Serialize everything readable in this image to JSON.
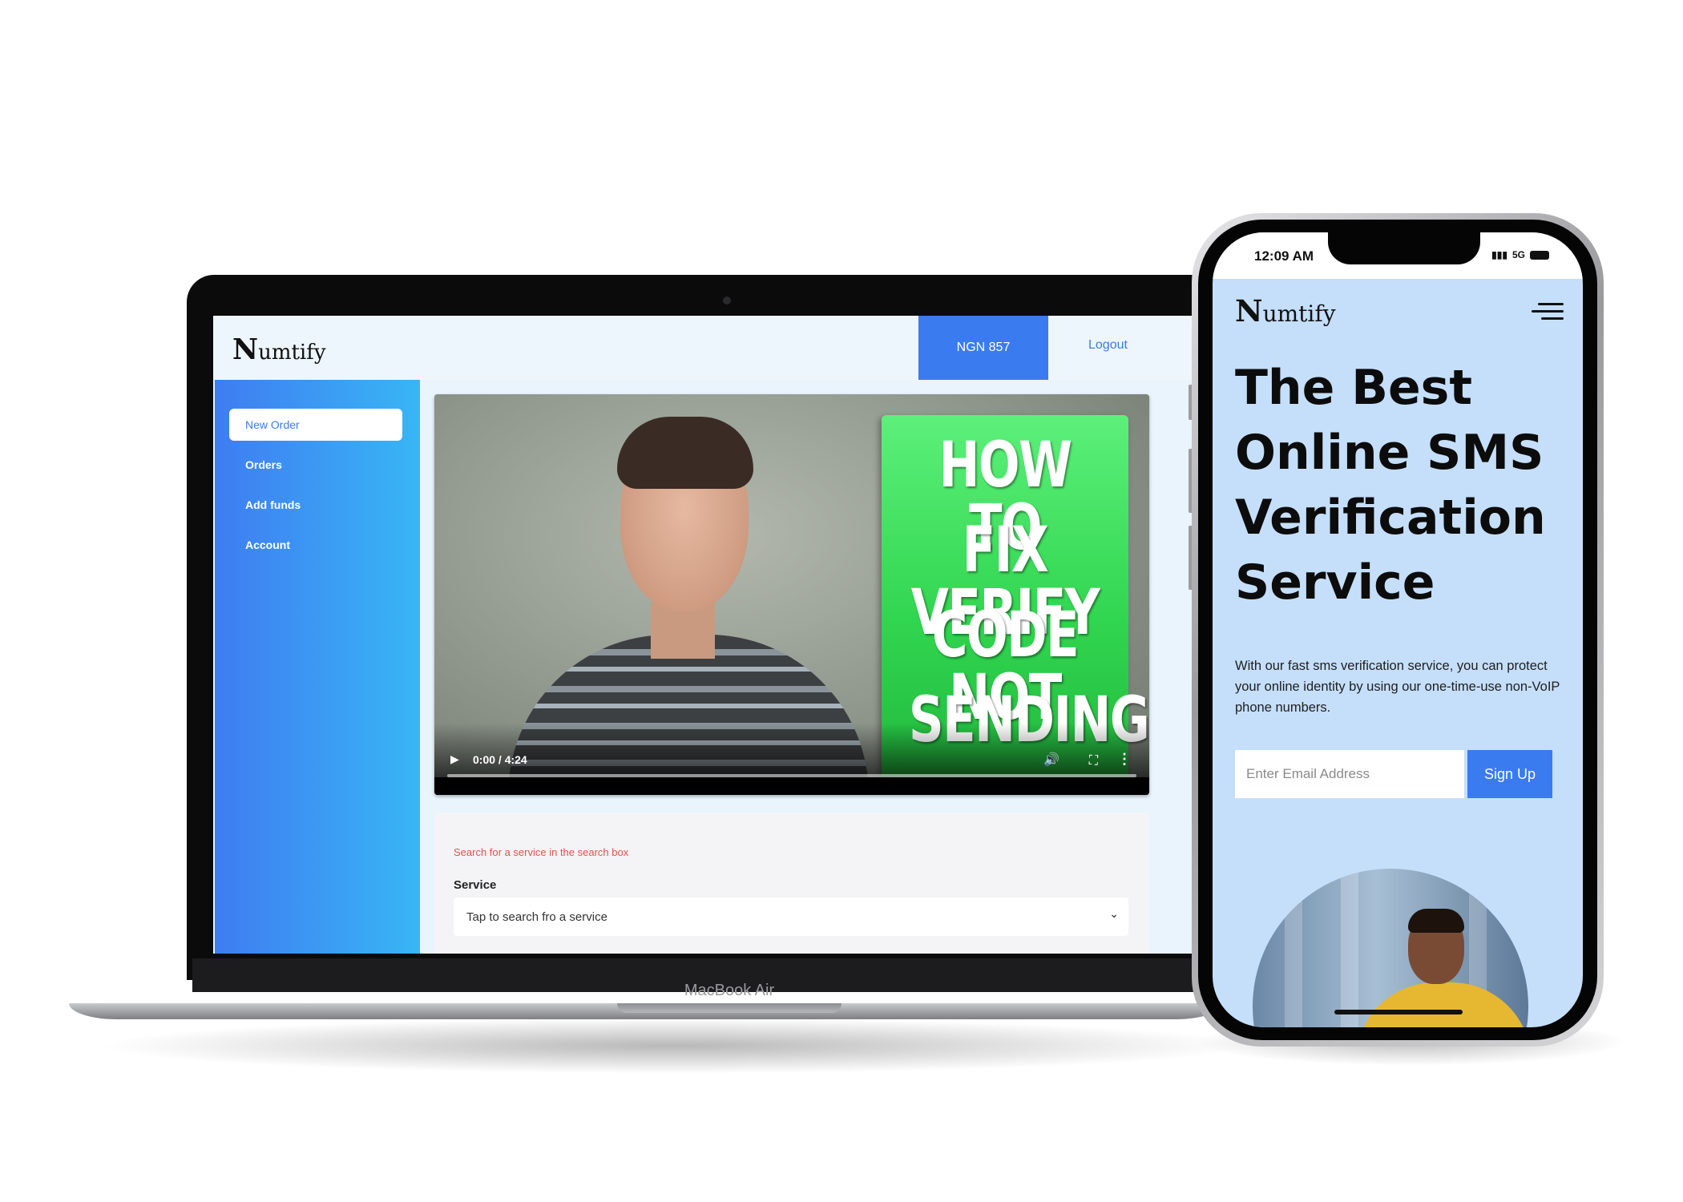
{
  "laptop": {
    "brand": "MacBook Air",
    "app": {
      "logo_initial": "N",
      "logo_rest": "umtify",
      "balance": "NGN 857",
      "logout_label": "Logout",
      "sidebar": {
        "items": [
          {
            "label": "New Order",
            "active": true
          },
          {
            "label": "Orders",
            "active": false
          },
          {
            "label": "Add funds",
            "active": false
          },
          {
            "label": "Account",
            "active": false
          }
        ]
      },
      "video": {
        "thumbnail_lines": [
          "HOW TO",
          "FIX VERIFY",
          "CODE NOT",
          "SENDING"
        ],
        "time": "0:00 / 4:24",
        "progress": 0,
        "controls": [
          "play-icon",
          "volume-icon",
          "fullscreen-icon",
          "more-options-icon"
        ]
      },
      "form": {
        "hint": "Search for a service in the search box",
        "service_label": "Service",
        "service_placeholder": "Tap to search fro a service"
      }
    }
  },
  "phone": {
    "status": {
      "time": "12:09 AM",
      "network": "5G"
    },
    "app": {
      "logo_initial": "N",
      "logo_rest": "umtify",
      "menu_icon": "hamburger-menu-icon",
      "hero_lines": [
        "The Best",
        "Online SMS",
        "Verification",
        "Service"
      ],
      "description": "With our fast sms verification service, you can protect your online identity by using our one-time-use non-VoIP phone numbers.",
      "email_placeholder": "Enter Email Address",
      "signup_label": "Sign Up"
    }
  },
  "colors": {
    "accent": "#3a7bf0",
    "sidebar_gradient_start": "#3f7cf2",
    "sidebar_gradient_end": "#38b6f4",
    "phone_background": "#c5dffa",
    "thumbnail_green": "#30d54f",
    "hint_red": "#e0524e"
  }
}
